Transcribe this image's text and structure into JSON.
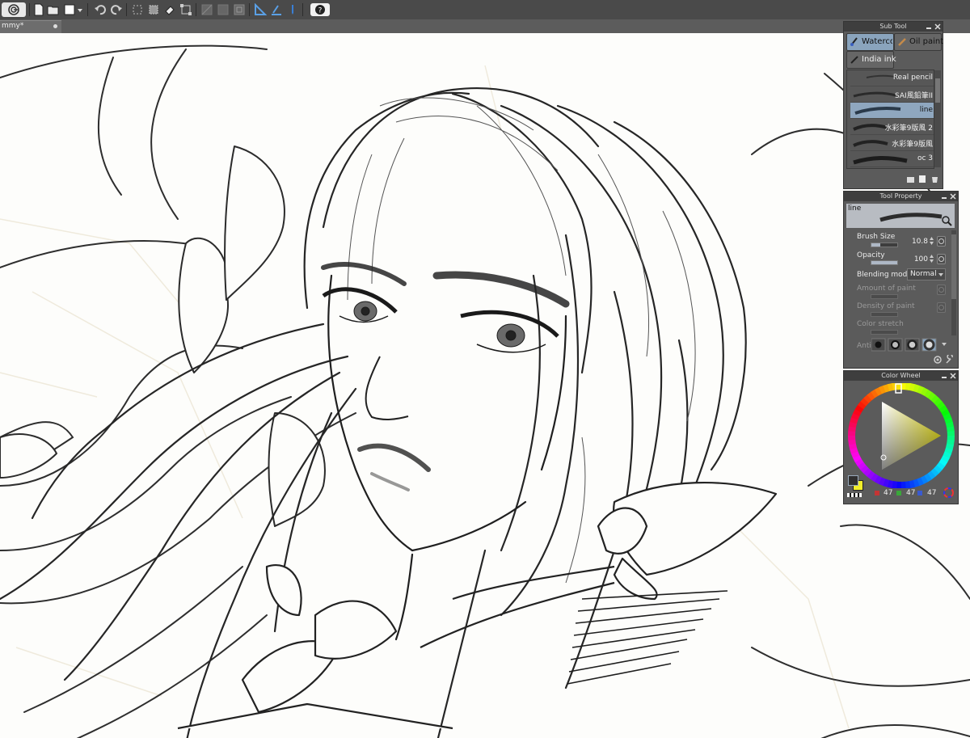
{
  "document": {
    "tab_title": "mmy*"
  },
  "toolbar": {
    "icons": [
      "app-logo-icon",
      "new-file-icon",
      "open-file-icon",
      "save-icon",
      "dropdown-icon",
      "undo-icon",
      "redo-icon",
      "clear-icon",
      "select-all-icon",
      "deselect-icon",
      "fill-icon",
      "transform-icon",
      "crop-icon",
      "shape-icon",
      "grid-icon",
      "ruler-icon",
      "snap-icon",
      "pen-pressure-icon",
      "help-icon"
    ]
  },
  "sub_tool": {
    "title": "Sub Tool",
    "groups": [
      {
        "label": "Waterco",
        "selected": true,
        "icon": "watercolor-brush-icon"
      },
      {
        "label": "Oil paint",
        "selected": false,
        "icon": "oil-paint-brush-icon"
      },
      {
        "label": "India ink",
        "selected": false,
        "icon": "india-ink-brush-icon"
      }
    ],
    "brushes": [
      {
        "name": "Real pencil",
        "selected": false
      },
      {
        "name": "SAI風鉛筆II",
        "selected": false
      },
      {
        "name": "line",
        "selected": true
      },
      {
        "name": "水彩筆9版風 2",
        "selected": false
      },
      {
        "name": "水彩筆9版風",
        "selected": false
      },
      {
        "name": "oc 3",
        "selected": false
      }
    ]
  },
  "tool_property": {
    "title": "Tool Property",
    "brush_name": "line",
    "brush_size": {
      "label": "Brush Size",
      "value": "10.8",
      "level": 0.35
    },
    "opacity": {
      "label": "Opacity",
      "value": "100",
      "level": 1.0
    },
    "blending_mode": {
      "label": "Blending mode",
      "value": "Normal"
    },
    "amount_of_paint": {
      "label": "Amount of paint"
    },
    "density_of_paint": {
      "label": "Density of paint"
    },
    "color_stretch": {
      "label": "Color stretch"
    },
    "anti_alias": {
      "label": "Anti"
    }
  },
  "color_wheel": {
    "title": "Color Wheel",
    "main_color": "#2f2f2f",
    "sub_color": "#f1ee2a",
    "hue_color": "#e8e020",
    "r": "47",
    "g": "47",
    "b": "47"
  }
}
